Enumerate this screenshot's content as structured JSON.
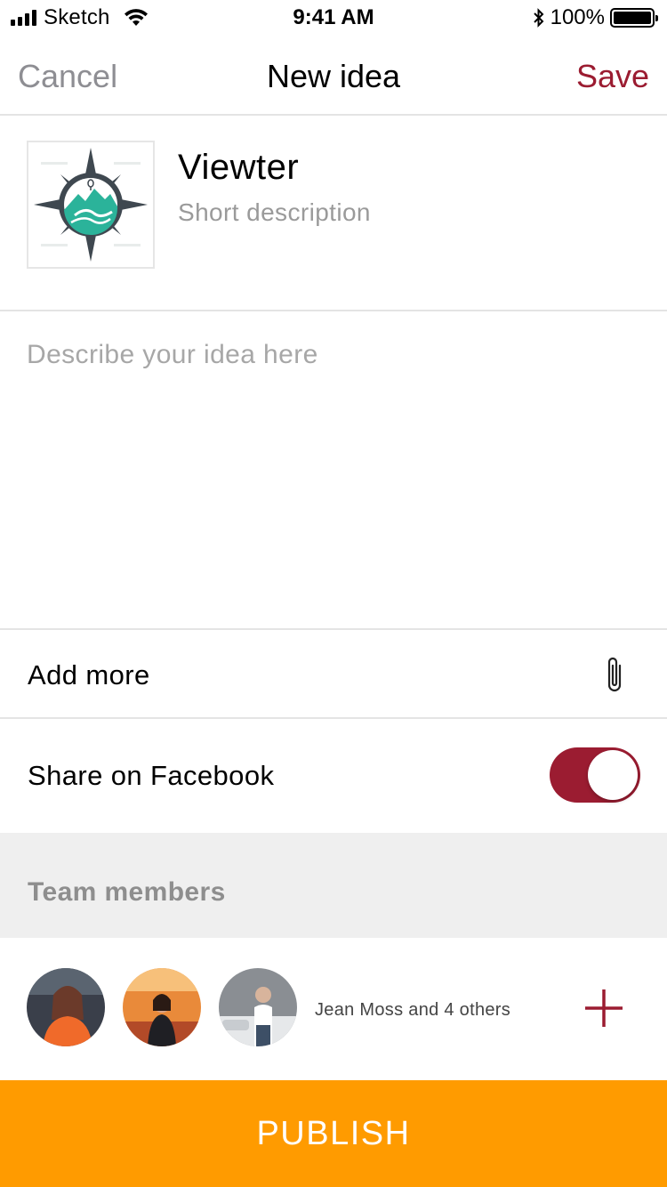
{
  "status_bar": {
    "carrier": "Sketch",
    "time": "9:41 AM",
    "battery_percent": "100%",
    "battery_level": 1.0
  },
  "nav": {
    "cancel_label": "Cancel",
    "title": "New idea",
    "save_label": "Save"
  },
  "project": {
    "name": "Viewter",
    "description_placeholder": "Short description",
    "logo_icon": "compass-mountain-logo"
  },
  "idea": {
    "placeholder": "Describe your idea here",
    "value": ""
  },
  "attachments": {
    "label": "Add more",
    "icon": "paperclip-icon"
  },
  "share_facebook": {
    "label": "Share on Facebook",
    "enabled": true
  },
  "team": {
    "section_title": "Team members",
    "summary": "Jean Moss and 4 others",
    "add_icon": "plus-icon"
  },
  "publish": {
    "label": "PUBLISH"
  },
  "colors": {
    "accent": "#9b1c31",
    "publish": "#ff9b00",
    "section_bg": "#efefef",
    "divider": "#e4e4e4",
    "muted_text": "#8e8e93"
  }
}
